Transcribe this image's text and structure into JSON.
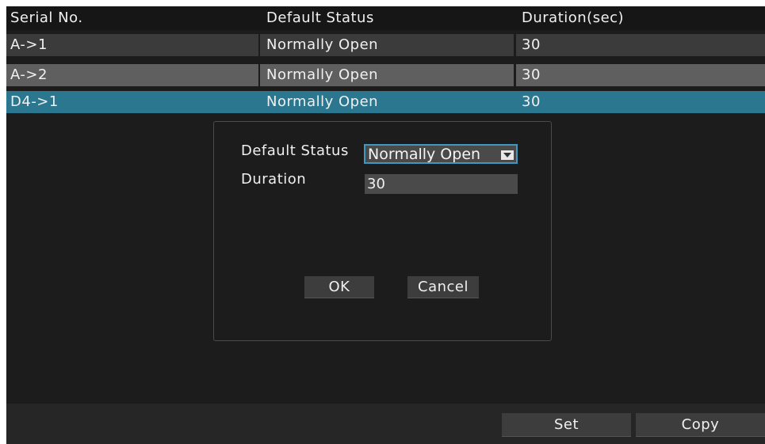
{
  "table": {
    "columns": [
      "Serial No.",
      "Default Status",
      "Duration(sec)"
    ],
    "rows": [
      {
        "serial": "A->1",
        "status": "Normally Open",
        "duration": "30"
      },
      {
        "serial": "A->2",
        "status": "Normally Open",
        "duration": "30"
      },
      {
        "serial": "D4->1",
        "status": "Normally Open",
        "duration": "30"
      }
    ],
    "selected_row": "D4->1"
  },
  "dialog": {
    "status_label": "Default Status",
    "status_value": "Normally Open",
    "duration_label": "Duration",
    "duration_value": "30",
    "ok_label": "OK",
    "cancel_label": "Cancel"
  },
  "footer": {
    "set_label": "Set",
    "copy_label": "Copy"
  },
  "icons": {
    "dropdown": "chevron-down-icon"
  },
  "colors": {
    "selection": "#2b7790",
    "focus_border": "#3f98c2"
  }
}
